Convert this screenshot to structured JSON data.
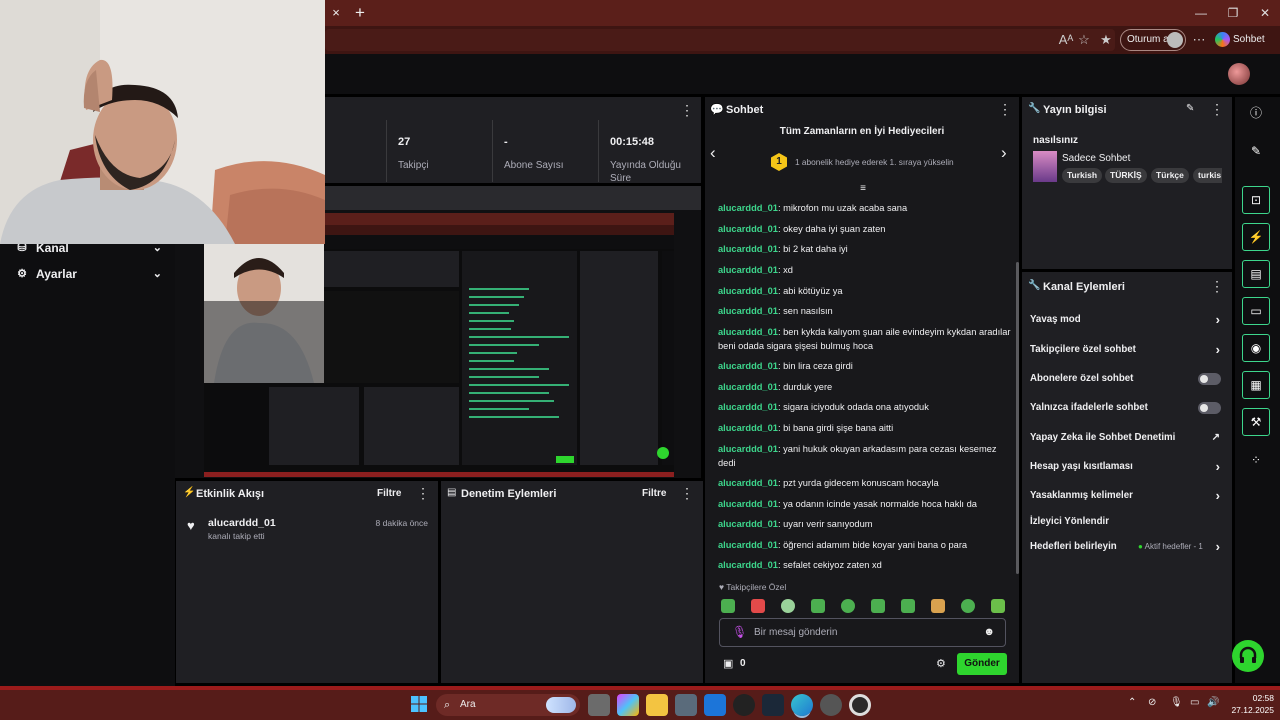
{
  "browser": {
    "close_tab_glyph": "×",
    "new_tab_glyph": "+",
    "signin_label": "Oturum aç",
    "copilot_label": "Sohbet et",
    "accent": "#5b1f1a"
  },
  "left_nav": {
    "items": [
      {
        "label": "Kanal",
        "icon": "channel-icon"
      },
      {
        "label": "Ayarlar",
        "icon": "gear-icon"
      }
    ]
  },
  "stats": {
    "items": [
      {
        "value": "27",
        "label": "Takipçi"
      },
      {
        "value": "-",
        "label": "Abone Sayısı"
      },
      {
        "value": "00:15:48",
        "label": "Yayında Olduğu Süre"
      }
    ]
  },
  "activity": {
    "title": "Etkinlik Akışı",
    "filter": "Filtre",
    "events": [
      {
        "user": "alucarddd_01",
        "action": "kanalı takip etti",
        "time": "8 dakika önce"
      }
    ]
  },
  "moderation": {
    "title": "Denetim Eylemleri",
    "filter": "Filtre"
  },
  "chat": {
    "title": "Sohbet",
    "gifters_title": "Tüm Zamanların en İyi Hediyecileri",
    "gifters_rank": "1",
    "gifters_text": "1 abonelik hediye ederek 1. sıraya yükselin",
    "messages": [
      {
        "user": "alucarddd_01",
        "text": ": mikrofon mu uzak acaba sana"
      },
      {
        "user": "alucarddd_01",
        "text": ": okey daha iyi şuan zaten"
      },
      {
        "user": "alucarddd_01",
        "text": ": bi 2 kat daha iyi"
      },
      {
        "user": "alucarddd_01",
        "text": ": xd"
      },
      {
        "user": "alucarddd_01",
        "text": ": abi kötüyüz ya"
      },
      {
        "user": "alucarddd_01",
        "text": ": sen nasılsın"
      },
      {
        "user": "alucarddd_01",
        "text": ": ben kykda kalıyom şuan aile evindeyim kykdan aradılar beni odada sigara şişesi bulmuş hoca"
      },
      {
        "user": "alucarddd_01",
        "text": ": bin lira ceza girdi"
      },
      {
        "user": "alucarddd_01",
        "text": ": durduk yere"
      },
      {
        "user": "alucarddd_01",
        "text": ": sigara iciyoduk odada ona atıyoduk"
      },
      {
        "user": "alucarddd_01",
        "text": ": bi bana girdi şişe bana aitti"
      },
      {
        "user": "alucarddd_01",
        "text": ": yani hukuk okuyan arkadasım para cezası kesemez dedi"
      },
      {
        "user": "alucarddd_01",
        "text": ": pzt yurda gidecem konuscam hocayla"
      },
      {
        "user": "alucarddd_01",
        "text": ": ya odanın icinde yasak normalde hoca haklı da"
      },
      {
        "user": "alucarddd_01",
        "text": ": uyarı verir sanıyodum"
      },
      {
        "user": "alucarddd_01",
        "text": ": öğrenci adamım bide koyar yani bana o para"
      },
      {
        "user": "alucarddd_01",
        "text": ": sefalet cekiyoz zaten xd"
      }
    ],
    "followers_only_label": "Takipçilere Özel",
    "input_placeholder": "Bir mesaj gönderin",
    "points": "0",
    "send_label": "Gönder"
  },
  "stream_info": {
    "title": "Yayın bilgisi",
    "stream_title": "nasılsınız",
    "category": "Sadece Sohbet",
    "tags": [
      "Turkish",
      "TÜRKİŞ",
      "Türkçe",
      "turkis"
    ]
  },
  "channel_actions": {
    "title": "Kanal Eylemleri",
    "rows": [
      {
        "label": "Yavaş mod",
        "kind": "chevron"
      },
      {
        "label": "Takipçilere özel sohbet",
        "kind": "chevron"
      },
      {
        "label": "Abonelere özel sohbet",
        "kind": "toggle"
      },
      {
        "label": "Yalnızca ifadelerle sohbet",
        "kind": "toggle"
      },
      {
        "label": "Yapay Zeka ile Sohbet Denetimi",
        "kind": "external"
      },
      {
        "label": "Hesap yaşı kısıtlaması",
        "kind": "chevron"
      },
      {
        "label": "Yasaklanmış kelimeler",
        "kind": "chevron"
      },
      {
        "label": "İzleyici Yönlendir",
        "kind": "none"
      },
      {
        "label": "Hedefleri belirleyin",
        "kind": "goals"
      }
    ],
    "goals_status": "Aktif hedefler - 1"
  },
  "taskbar": {
    "search_label": "Ara",
    "time": "02:58",
    "date": "27.12.2025"
  },
  "colors": {
    "brand_green": "#2ed52e",
    "username_green": "#3dd68c",
    "panel_bg": "#1f1f23"
  }
}
